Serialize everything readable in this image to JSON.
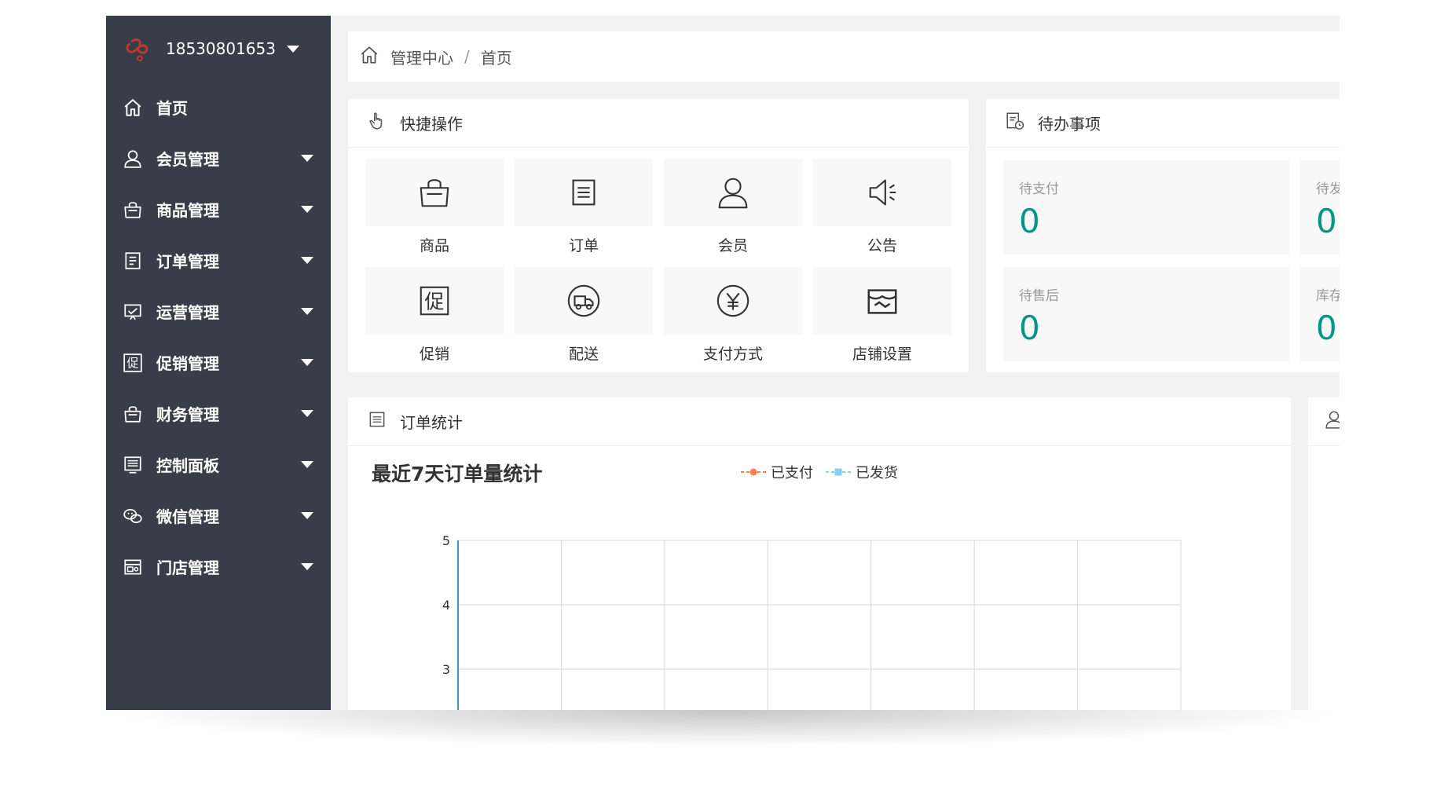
{
  "sidebar": {
    "username": "18530801653",
    "items": [
      {
        "label": "首页",
        "icon": "home-icon",
        "expandable": false
      },
      {
        "label": "会员管理",
        "icon": "user-icon",
        "expandable": true
      },
      {
        "label": "商品管理",
        "icon": "bag-icon",
        "expandable": true
      },
      {
        "label": "订单管理",
        "icon": "order-icon",
        "expandable": true
      },
      {
        "label": "运营管理",
        "icon": "operation-icon",
        "expandable": true
      },
      {
        "label": "促销管理",
        "icon": "promotion-icon",
        "expandable": true
      },
      {
        "label": "财务管理",
        "icon": "finance-icon",
        "expandable": true
      },
      {
        "label": "控制面板",
        "icon": "panel-icon",
        "expandable": true
      },
      {
        "label": "微信管理",
        "icon": "wechat-icon",
        "expandable": true
      },
      {
        "label": "门店管理",
        "icon": "store-icon",
        "expandable": true
      }
    ]
  },
  "breadcrumb": {
    "root": "管理中心",
    "separator": "/",
    "current": "首页"
  },
  "quick": {
    "title": "快捷操作",
    "items": [
      {
        "label": "商品",
        "icon": "bag-icon"
      },
      {
        "label": "订单",
        "icon": "order-icon"
      },
      {
        "label": "会员",
        "icon": "user-icon"
      },
      {
        "label": "公告",
        "icon": "announcement-icon"
      },
      {
        "label": "促销",
        "icon": "promotion-icon"
      },
      {
        "label": "配送",
        "icon": "delivery-icon"
      },
      {
        "label": "支付方式",
        "icon": "yuan-icon"
      },
      {
        "label": "店铺设置",
        "icon": "shop-settings-icon"
      }
    ]
  },
  "todo": {
    "title": "待办事项",
    "items": [
      {
        "label": "待支付",
        "value": "0"
      },
      {
        "label": "待发货",
        "value": "0"
      },
      {
        "label": "待售后",
        "value": "0"
      },
      {
        "label": "库存预警",
        "value": "0"
      }
    ]
  },
  "stats": {
    "title": "订单统计"
  },
  "chart_data": {
    "type": "line",
    "title": "最近7天订单量统计",
    "legend": [
      "已支付",
      "已发货"
    ],
    "series": [
      {
        "name": "已支付",
        "color": "#ff7f50"
      },
      {
        "name": "已发货",
        "color": "#87cefa"
      }
    ],
    "y_ticks": [
      "5",
      "4",
      "3"
    ],
    "ylim": [
      2,
      5
    ],
    "grid": true,
    "legend_position": "top-center",
    "x_divisions": 7
  },
  "colors": {
    "sidebar_bg": "#393d49",
    "accent": "#009688",
    "paid": "#ff7f50",
    "shipped": "#87cefa"
  }
}
